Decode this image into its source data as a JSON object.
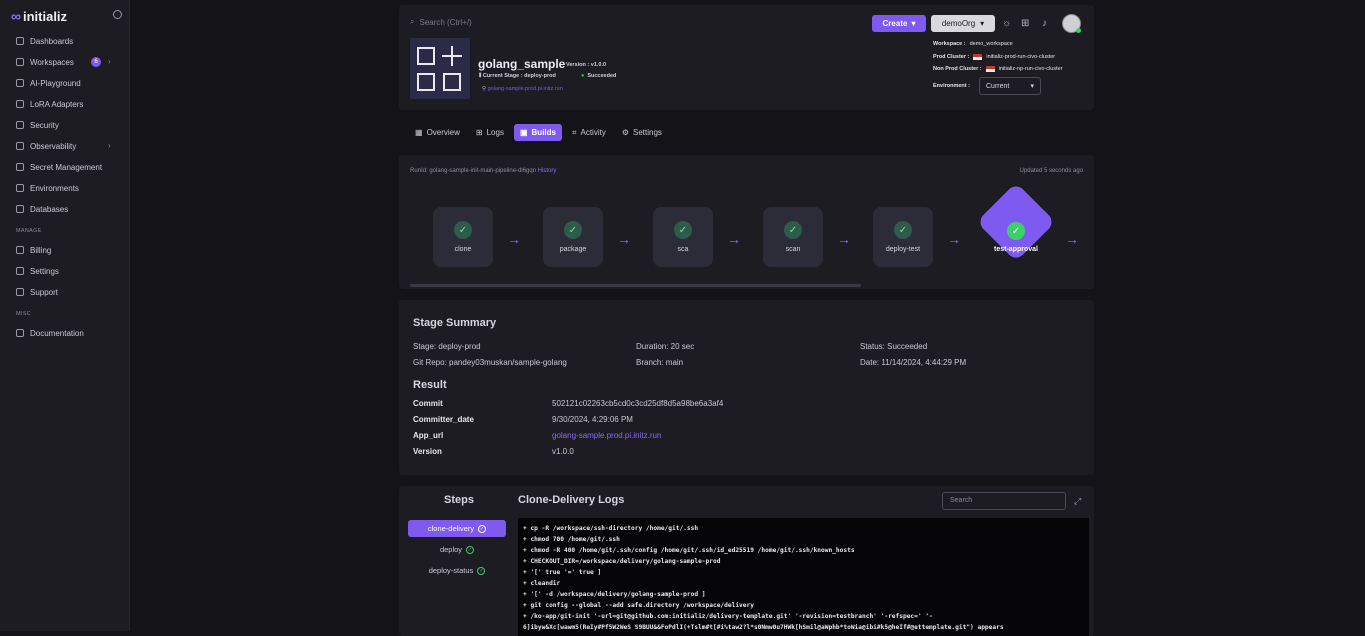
{
  "brand": {
    "name": "initializ"
  },
  "sidebar": {
    "items": [
      {
        "label": "Dashboards"
      },
      {
        "label": "Workspaces",
        "badge": "6"
      },
      {
        "label": "AI-Playground"
      },
      {
        "label": "LoRA Adapters"
      },
      {
        "label": "Security"
      },
      {
        "label": "Observability"
      },
      {
        "label": "Secret Management"
      },
      {
        "label": "Environments"
      },
      {
        "label": "Databases"
      }
    ],
    "manage_label": "MANAGE",
    "manage_items": [
      {
        "label": "Billing"
      },
      {
        "label": "Settings"
      },
      {
        "label": "Support"
      }
    ],
    "misc_label": "MISC",
    "misc_items": [
      {
        "label": "Documentation"
      }
    ]
  },
  "header": {
    "search_placeholder": "Search (Ctrl+/)",
    "create_label": "Create",
    "org_label": "demoOrg"
  },
  "app": {
    "name": "golang_sample",
    "version": "Version : v1.0.0",
    "current_stage": "Current Stage : deploy-prod",
    "status": "Succeeded",
    "url": "golang-sample.prod.pi.initz.run",
    "workspace_label": "Workspace :",
    "workspace": "demo_workspace",
    "prod_cluster_label": "Prod Cluster :",
    "prod_cluster": "initializ-prod-run-civo-cluster",
    "nonprod_cluster_label": "Non Prod Cluster :",
    "nonprod_cluster": "initializ-np-run-civo-cluster",
    "environment_label": "Environment :",
    "environment": "Current"
  },
  "tabs": [
    {
      "label": "Overview",
      "icon": "grid-icon"
    },
    {
      "label": "Logs",
      "icon": "logs-icon"
    },
    {
      "label": "Builds",
      "icon": "builds-icon",
      "active": true
    },
    {
      "label": "Activity",
      "icon": "activity-icon"
    },
    {
      "label": "Settings",
      "icon": "gear-icon"
    }
  ],
  "pipeline": {
    "runid": "RunId: golang-sample-init-main-pipeline-dl6gqn",
    "history": "History",
    "updated": "Updated 5 seconds ago",
    "stages": [
      "clone",
      "package",
      "sca",
      "scan",
      "deploy-test"
    ],
    "active_stage": "test-approval"
  },
  "summary": {
    "title": "Stage Summary",
    "stage": "Stage: deploy-prod",
    "duration": "Duration: 20 sec",
    "status": "Status: Succeeded",
    "repo": "Git Repo: pandey03muskan/sample-golang",
    "branch": "Branch: main",
    "date": "Date: 11/14/2024, 4:44:29 PM",
    "result_title": "Result",
    "rows": [
      {
        "key": "Commit",
        "value": "502121c02263cb5cd0c3cd25df8d5a98be6a3af4"
      },
      {
        "key": "Committer_date",
        "value": "9/30/2024, 4:29:06 PM"
      },
      {
        "key": "App_url",
        "value": "golang-sample.prod.pi.initz.run"
      },
      {
        "key": "Version",
        "value": "v1.0.0"
      }
    ]
  },
  "logs": {
    "steps_title": "Steps",
    "title": "Clone-Delivery Logs",
    "search_placeholder": "Search",
    "steps": [
      {
        "label": "clone-delivery",
        "active": true
      },
      {
        "label": "deploy"
      },
      {
        "label": "deploy-status"
      }
    ],
    "lines": [
      "+ cp -R /workspace/ssh-directory /home/git/.ssh",
      "+ chmod 700 /home/git/.ssh",
      "+ chmod -R 400 /home/git/.ssh/config /home/git/.ssh/id_ed25519 /home/git/.ssh/known_hosts",
      "+ CHECKOUT_DIR=/workspace/delivery/golang-sample-prod",
      "+ '[' true '=' true ]",
      "+ cleandir",
      "+ '[' -d /workspace/delivery/golang-sample-prod ]",
      "+ git config --global --add safe.directory /workspace/delivery",
      "+ /ko-app/git-init '-url=git@github.com:initializ/delivery-template.git' '-revision=testbranch' '-refspec=' '-",
      "6]ibyw&Xc[wawm5(ReIy#Pf5W2WeS S9BUU&&FoPdlI(+Tslm#t[#i%taw2?l*s0Nmw0u7HWk[hSmil@aWphb*toWia@ibi#k5@heIf#@ettemplate.git\") appears"
    ]
  }
}
